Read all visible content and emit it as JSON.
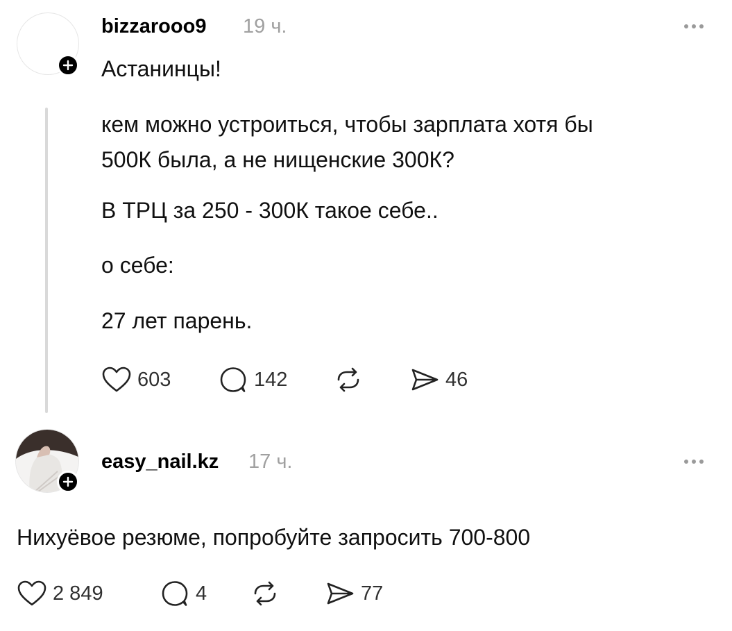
{
  "posts": [
    {
      "username": "bizzarooo9",
      "time": "19 ч.",
      "title": "Астанинцы!",
      "paragraphs": [
        "кем можно устроиться, чтобы зарплата хотя бы",
        "500К была, а не нищенские 300К?",
        "В ТРЦ за 250 - 300К такое себе..",
        "о себе:",
        "27 лет парень."
      ],
      "likes": "603",
      "comments": "142",
      "shares": "46"
    },
    {
      "username": "easy_nail.kz",
      "time": "17 ч.",
      "text": "Нихуёвое резюме, попробуйте запросить 700-800",
      "likes": "2 849",
      "comments": "4",
      "shares": "77"
    }
  ]
}
